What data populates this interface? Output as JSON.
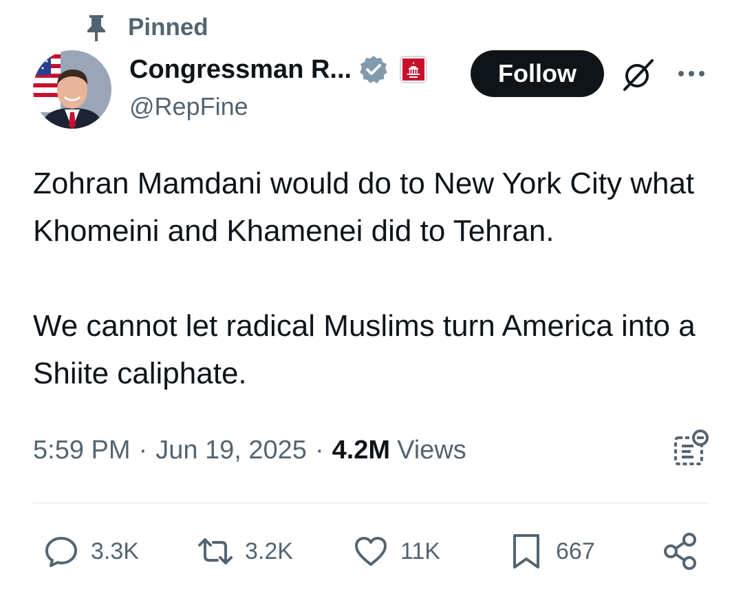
{
  "pinned": {
    "icon": "pin-icon",
    "label": "Pinned"
  },
  "author": {
    "display_name": "Congressman R...",
    "handle": "@RepFine",
    "verified_icon": "verified-badge-icon",
    "verified_color": "#829aab",
    "affiliation_badge_icon": "house-gop-badge-icon",
    "affiliation_color": "#c8102e"
  },
  "header_actions": {
    "follow_label": "Follow",
    "grok_icon": "grok-icon",
    "more_icon": "more-icon"
  },
  "tweet": {
    "paragraphs": [
      "Zohran Mamdani would do to New York City what Khomeini and Khamenei did to Tehran.",
      "We cannot let radical Muslims turn America into a Shiite caliphate."
    ]
  },
  "meta": {
    "time": "5:59 PM",
    "separator": "·",
    "date": "Jun 19, 2025",
    "views_count": "4.2M",
    "views_label": "Views",
    "analytics_icon": "analytics-icon"
  },
  "actions": {
    "reply": {
      "icon": "reply-icon",
      "count": "3.3K"
    },
    "retweet": {
      "icon": "retweet-icon",
      "count": "3.2K"
    },
    "like": {
      "icon": "heart-icon",
      "count": "11K"
    },
    "bookmark": {
      "icon": "bookmark-icon",
      "count": "667"
    },
    "share": {
      "icon": "share-icon"
    }
  },
  "colors": {
    "text_primary": "#0f1419",
    "text_secondary": "#536471",
    "divider": "#eff3f4"
  }
}
